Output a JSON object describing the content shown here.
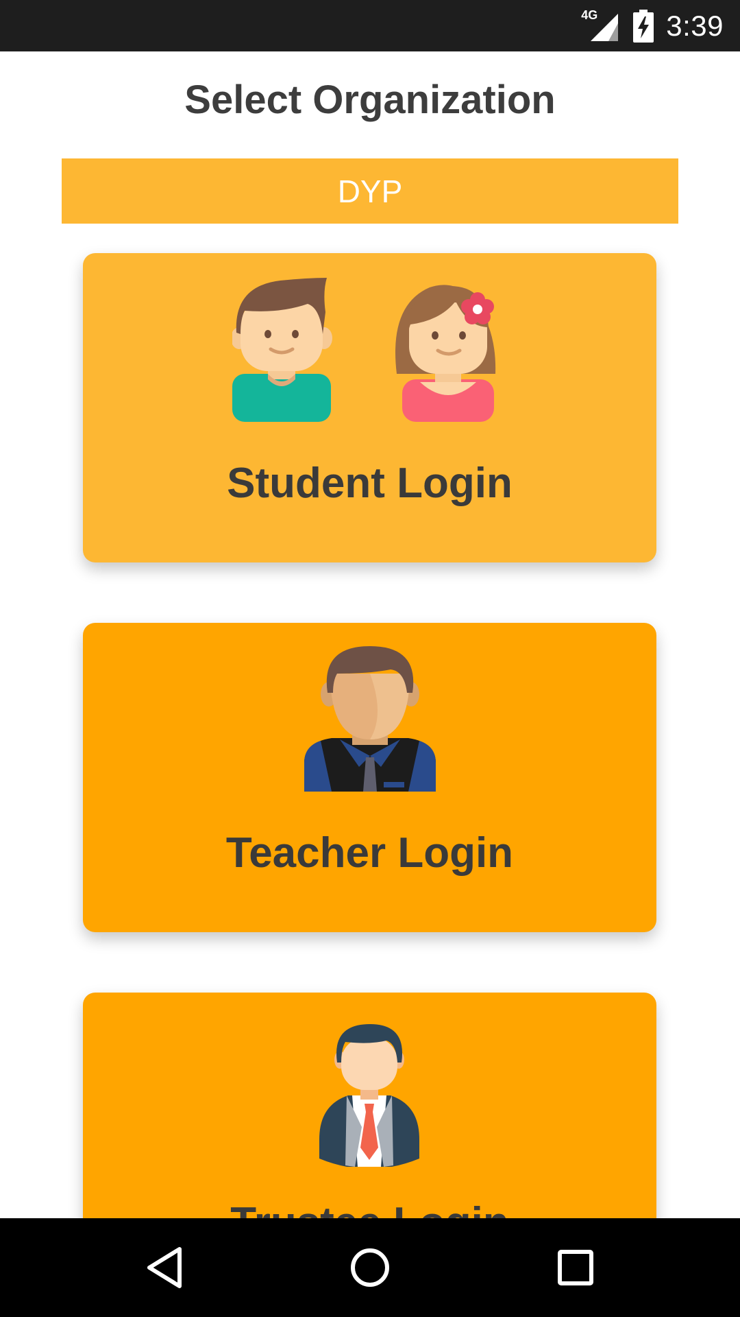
{
  "status_bar": {
    "network": "4G",
    "time": "3:39"
  },
  "page": {
    "title": "Select Organization"
  },
  "organization": {
    "selected": "DYP"
  },
  "login_options": [
    {
      "label": "Student Login"
    },
    {
      "label": "Teacher Login"
    },
    {
      "label": "Trustee Login"
    }
  ],
  "colors": {
    "status_bar_bg": "#1e1e1e",
    "org_bar_bg": "#fdb733",
    "student_card_bg": "#fdb733",
    "card_bg": "#ffa500",
    "title_text": "#3d3d3d",
    "nav_bar_bg": "#000000"
  },
  "icons": {
    "status": [
      "signal-icon",
      "battery-charging-icon"
    ],
    "cards": [
      "students-icon",
      "teacher-icon",
      "trustee-icon"
    ],
    "nav": [
      "back-icon",
      "home-icon",
      "recents-icon"
    ]
  }
}
